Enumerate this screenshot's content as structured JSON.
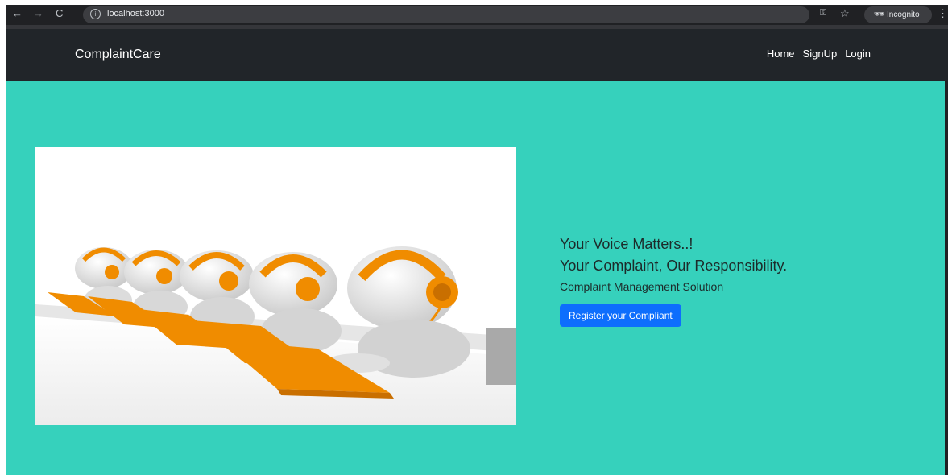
{
  "browser": {
    "url": "localhost:3000",
    "incognito_label": "Incognito",
    "back_icon": "←",
    "forward_icon": "→",
    "reload_icon": "C",
    "info_icon": "i",
    "key_icon": "⚿",
    "star_icon": "☆",
    "incognito_icon": "🕶",
    "menu_icon": "⋮"
  },
  "navbar": {
    "brand": "ComplaintCare",
    "links": [
      "Home",
      "SignUp",
      "Login"
    ]
  },
  "hero": {
    "line1": "Your Voice Matters..!",
    "line2": "Your Complaint, Our Responsibility.",
    "line3": "Complaint Management Solution",
    "button_label": "Register your Compliant"
  },
  "colors": {
    "hero_bg": "#36d1bc",
    "navbar_bg": "#212529",
    "button_bg": "#0d6efd",
    "headset_orange": "#f08c00"
  }
}
